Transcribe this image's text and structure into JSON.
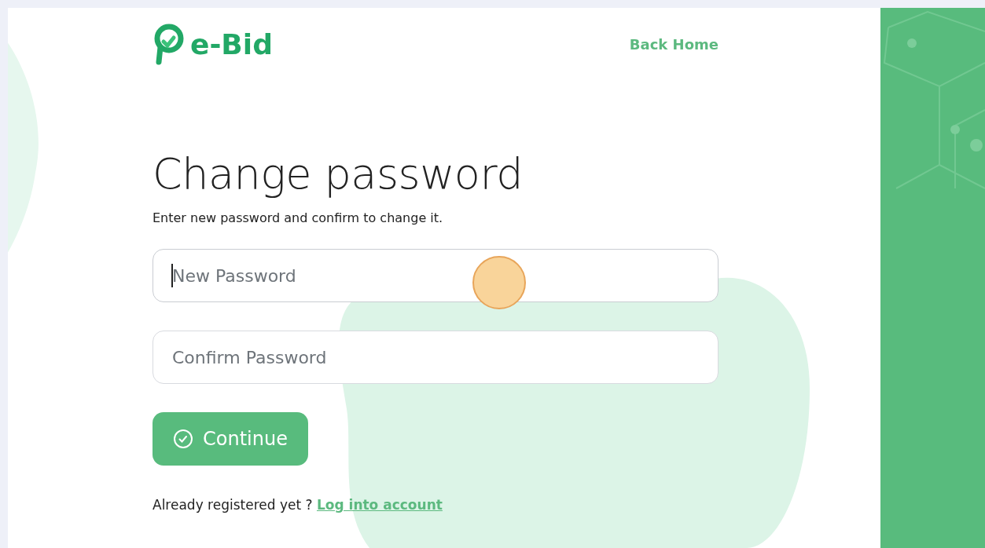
{
  "header": {
    "logo_text": "e-Bid",
    "back_link": "Back Home"
  },
  "title": "Change password",
  "subtitle": "Enter new password and confirm to change it.",
  "fields": [
    {
      "placeholder": "New Password",
      "focused": true
    },
    {
      "placeholder": "Confirm Password",
      "focused": false
    }
  ],
  "submit_button": "Continue",
  "footer": {
    "text": "Already registered yet ?",
    "link": "Log into account"
  }
}
